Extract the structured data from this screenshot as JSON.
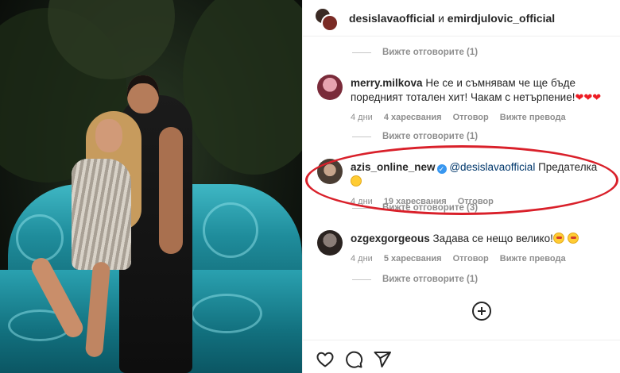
{
  "header": {
    "user1": "desislavaofficial",
    "joiner": "и",
    "user2": "emirdjulovic_official"
  },
  "view_replies": [
    "Вижте отговорите (1)",
    "Вижте отговорите (1)",
    "Вижте отговорите (3)",
    "Вижте отговорите (1)"
  ],
  "comments": [
    {
      "username": "merry.milkova",
      "text": "Не се и съмнявам че ще бъде поредният тотален хит! Чакам с нетърпение!",
      "time": "4 дни",
      "likes": "4 харесвания",
      "reply": "Отговор",
      "translate": "Вижте превода",
      "emojis": [
        "heart",
        "heart",
        "heart"
      ]
    },
    {
      "username": "azis_online_new",
      "verified": true,
      "mention": "@desislavaofficial",
      "text": "Предателка",
      "time": "4 дни",
      "likes": "19 харесвания",
      "reply": "Отговор",
      "emojis": [
        "smile"
      ]
    },
    {
      "username": "ozgexgorgeous",
      "text": "Задава се нещо велико!",
      "time": "4 дни",
      "likes": "5 харесвания",
      "reply": "Отговор",
      "translate": "Вижте превода",
      "emojis": [
        "star-struck",
        "star-struck"
      ]
    }
  ],
  "icons": {
    "like": "heart-icon",
    "comment": "comment-icon",
    "share": "send-icon",
    "add": "plus-circle-icon"
  },
  "colors": {
    "highlight_oval": "#d9202a",
    "meta_text": "#8e8e8e",
    "mention": "#00376b"
  }
}
